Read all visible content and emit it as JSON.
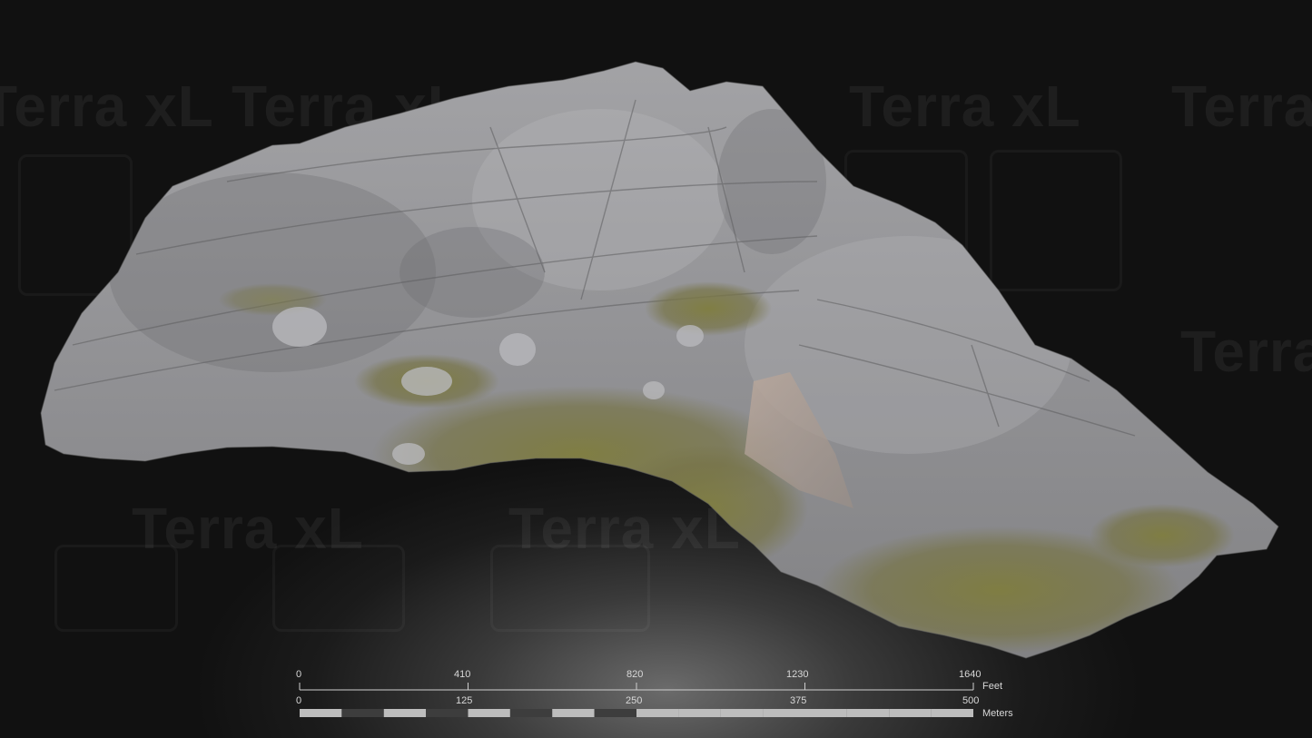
{
  "watermark": {
    "text": "Terra xL"
  },
  "scale_bar": {
    "feet": {
      "ticks": [
        "0",
        "410",
        "820",
        "1230",
        "1640"
      ],
      "unit": "Feet"
    },
    "meters": {
      "ticks": [
        "0",
        "125",
        "250",
        "375",
        "500"
      ],
      "unit": "Meters"
    },
    "colors": {
      "light": "#bdbdbd",
      "dark": "#3d3d3d",
      "line": "#cfcfcf"
    }
  },
  "model": {
    "rock_color": "#9a9a9c",
    "grass_color": "#7b7a45",
    "scree_color": "#b3a39a"
  }
}
